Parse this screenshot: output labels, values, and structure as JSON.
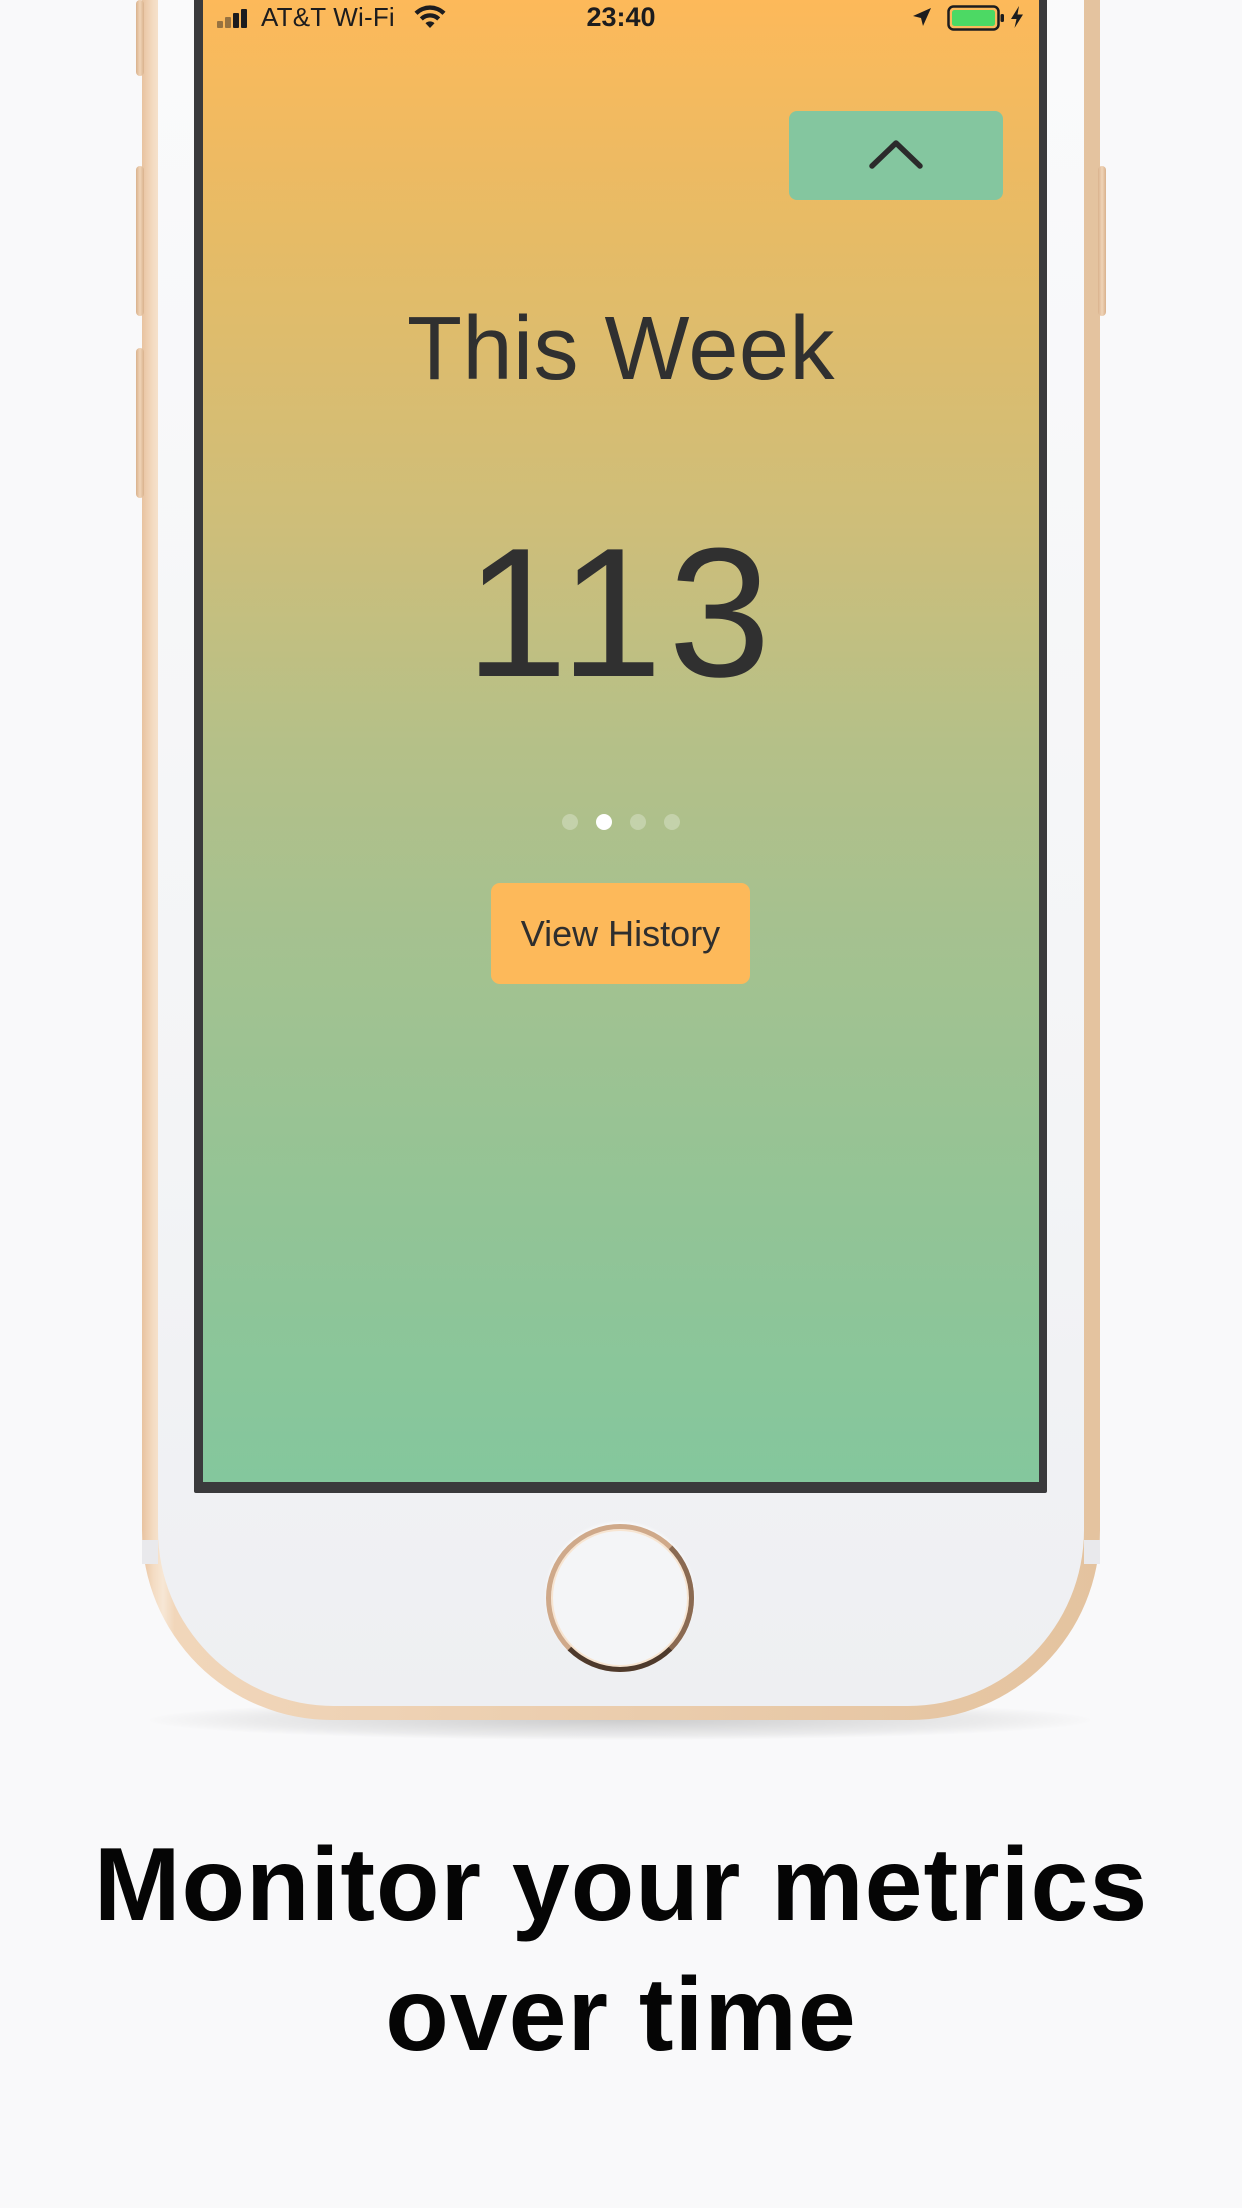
{
  "status_bar": {
    "carrier": "AT&T Wi-Fi",
    "time": "23:40",
    "icons": [
      "signal-bars-icon",
      "wifi-icon",
      "location-arrow-icon",
      "battery-icon",
      "charging-bolt-icon"
    ]
  },
  "app": {
    "collapse_icon": "chevron-up-icon",
    "title": "This Week",
    "metric_value": "113",
    "pagination": {
      "total_pages": 4,
      "active_page": 2
    },
    "history_button_label": "View History",
    "colors": {
      "gradient_top": "#fdb95a",
      "gradient_bottom": "#84c79d",
      "accent_green": "#84c69f",
      "accent_orange": "#fdb95a",
      "text": "#303030"
    }
  },
  "caption": {
    "line1": "Monitor your metrics",
    "line2": "over time"
  }
}
